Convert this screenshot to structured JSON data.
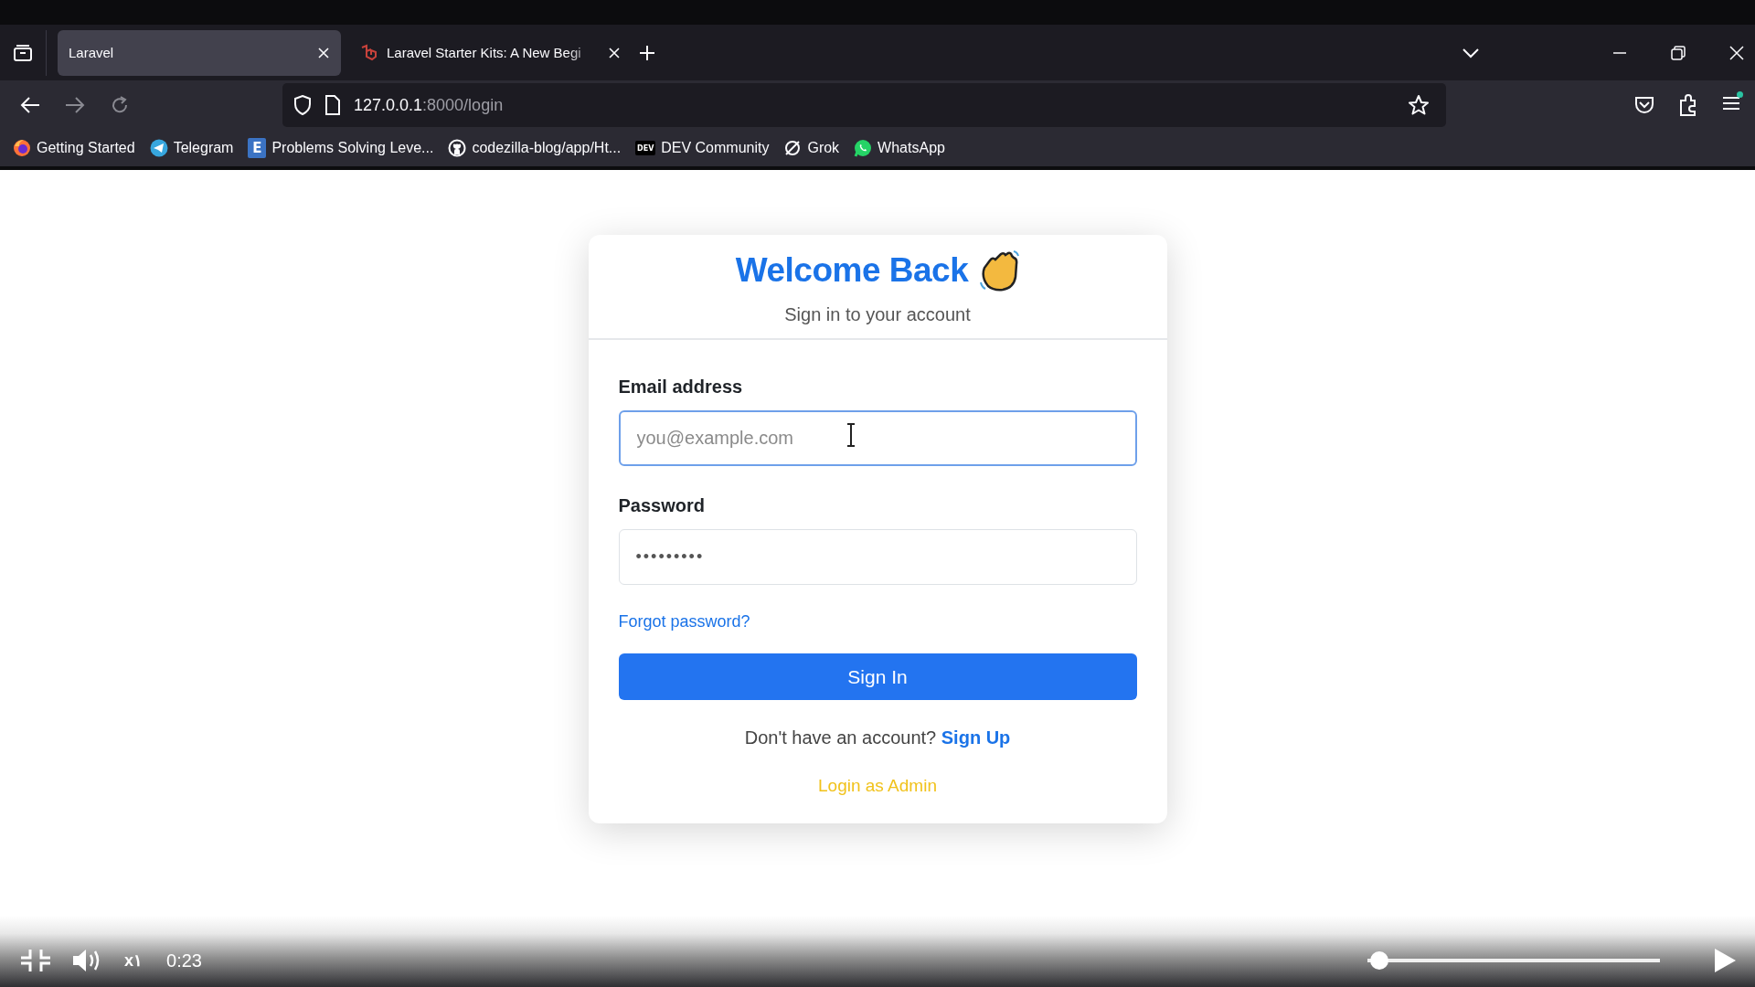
{
  "browser": {
    "tabs": [
      {
        "title": "Laravel",
        "selected": true,
        "favicon": false
      },
      {
        "title": "Laravel Starter Kits: A New Begi",
        "selected": false,
        "favicon": true
      }
    ],
    "address": {
      "host": "127.0.0.1",
      "path": ":8000/login"
    },
    "bookmarks": [
      {
        "label": "Getting Started",
        "kind": "fox"
      },
      {
        "label": "Telegram",
        "kind": "plane"
      },
      {
        "label": "Problems Solving Leve...",
        "kind": "letter",
        "badge": "E"
      },
      {
        "label": "codezilla-blog/app/Ht...",
        "kind": "cat"
      },
      {
        "label": "DEV Community",
        "kind": "letter",
        "badge": "DEV"
      },
      {
        "label": "Grok",
        "kind": "slash"
      },
      {
        "label": "WhatsApp",
        "kind": "chat"
      }
    ],
    "menu_notification": true
  },
  "login": {
    "title": "Welcome Back",
    "subtitle": "Sign in to your account",
    "fields": [
      {
        "label": "Email address",
        "placeholder": "you@example.com",
        "focused": true
      },
      {
        "label": "Password",
        "value": "•••••••••",
        "focused": false
      }
    ],
    "forgot_link": "Forgot password?",
    "submit": "Sign In",
    "signup_prompt": "Don't have an account?",
    "signup_link": "Sign Up",
    "admin_link": "Login as Admin"
  },
  "player": {
    "time": "0:23",
    "speed": "x١",
    "progress": {
      "level": 0.01
    }
  }
}
